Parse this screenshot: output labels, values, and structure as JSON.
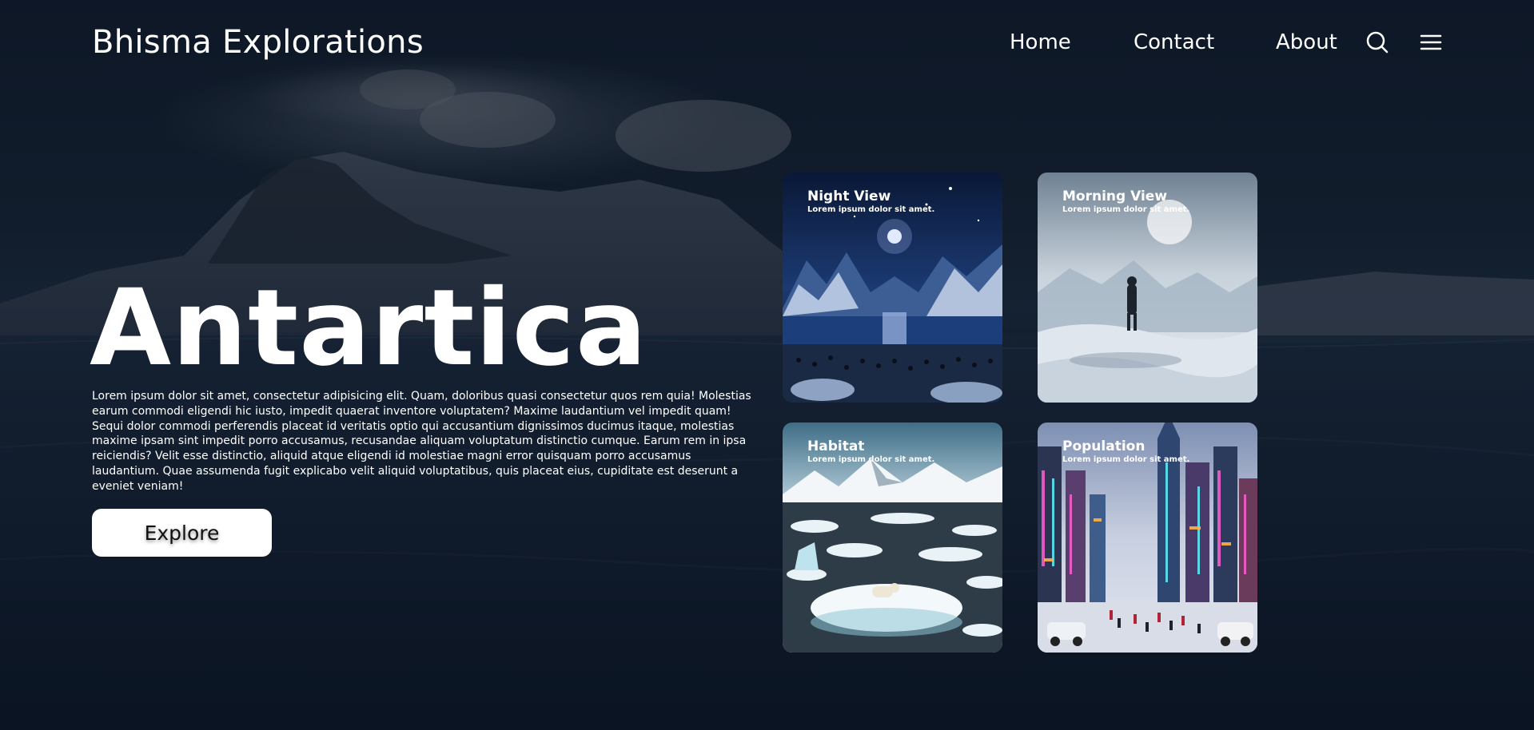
{
  "header": {
    "brand": "Bhisma Explorations",
    "nav": [
      {
        "label": "Home"
      },
      {
        "label": "Contact"
      },
      {
        "label": "About"
      }
    ],
    "icons": [
      "search-icon",
      "menu-icon"
    ]
  },
  "hero": {
    "title": "Antartica",
    "description": "Lorem ipsum dolor sit amet, consectetur adipisicing elit. Quam, doloribus quasi consectetur quos rem quia! Molestias earum commodi eligendi hic iusto, impedit quaerat inventore voluptatem? Maxime laudantium vel impedit quam! Sequi dolor commodi perferendis placeat id veritatis optio qui accusantium dignissimos ducimus itaque, molestias maxime ipsam sint impedit porro accusamus, recusandae aliquam voluptatum distinctio cumque. Earum rem in ipsa reiciendis? Velit esse distinctio, aliquid atque eligendi id molestiae magni error quisquam porro accusamus laudantium. Quae assumenda fugit explicabo velit aliquid voluptatibus, quis placeat eius, cupiditate est deserunt a eveniet veniam!",
    "button_label": "Explore"
  },
  "cards": [
    {
      "title": "Night View",
      "subtitle": "Lorem ipsum dolor sit amet."
    },
    {
      "title": "Morning View",
      "subtitle": "Lorem ipsum dolor sit amet."
    },
    {
      "title": "Habitat",
      "subtitle": "Lorem ipsum dolor sit amet."
    },
    {
      "title": "Population",
      "subtitle": "Lorem ipsum dolor sit amet."
    }
  ],
  "colors": {
    "background": "#0d1726",
    "text": "#ffffff",
    "button_bg": "#ffffff",
    "button_text": "#111111"
  }
}
